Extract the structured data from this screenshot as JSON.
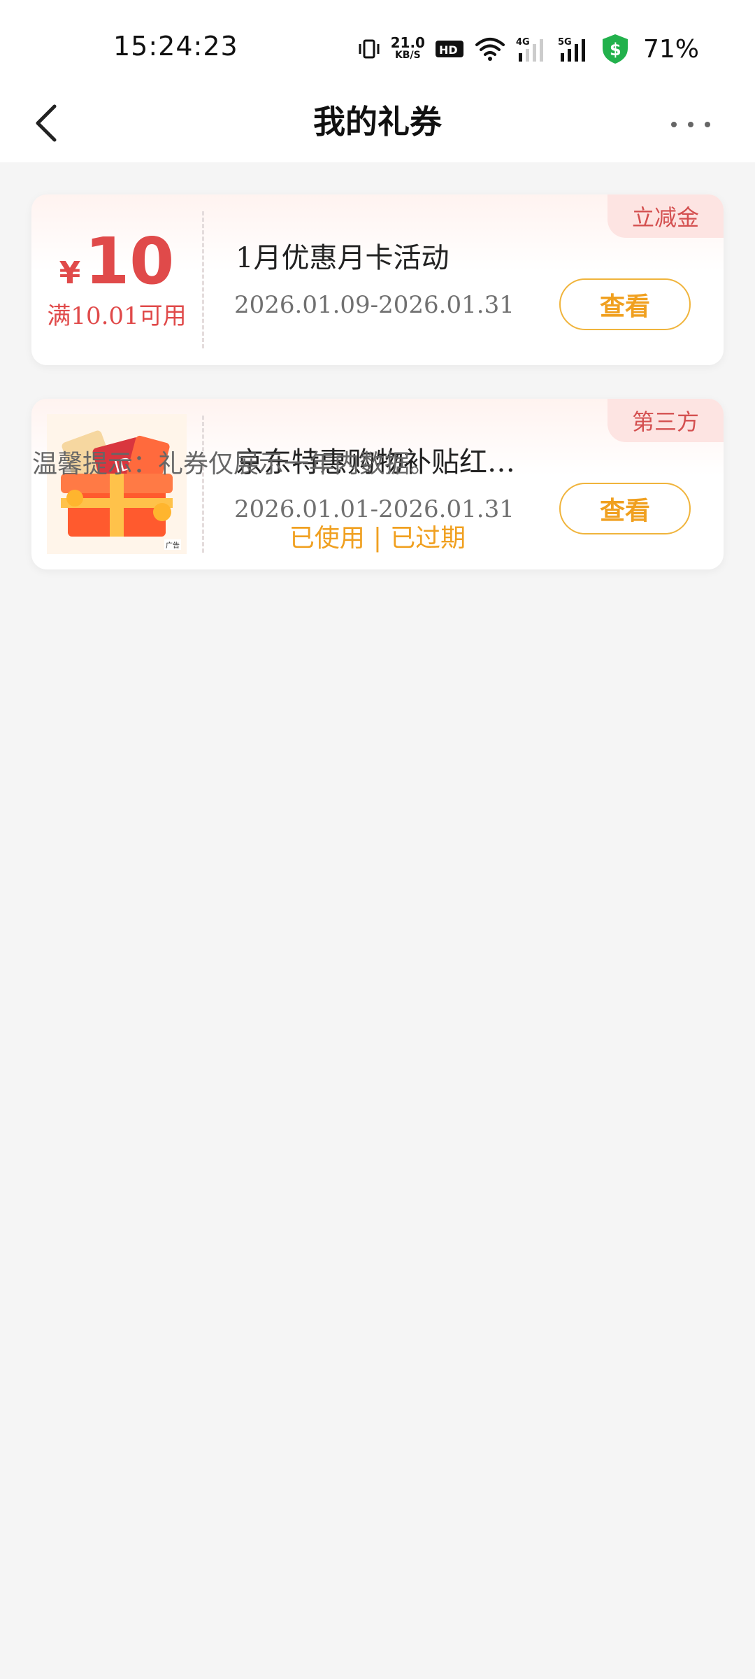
{
  "status_bar": {
    "time": "15:24:23",
    "net_speed": "21.0",
    "net_speed_unit": "KB/S",
    "battery": "71%",
    "icons": [
      "vibrate-icon",
      "hd-icon",
      "wifi-icon",
      "signal-4g-icon",
      "signal-5g-icon",
      "shield-dollar-icon"
    ]
  },
  "header": {
    "title": "我的礼券",
    "back_icon": "chevron-left-icon",
    "more_icon": "more-dots-icon"
  },
  "coupons": [
    {
      "currency": "¥",
      "amount": "10",
      "condition": "满10.01可用",
      "title": "1月优惠月卡活动",
      "date": "2026.01.09-2026.01.31",
      "button": "查看",
      "tag": "立减金"
    },
    {
      "image": "gift-box-image",
      "ad_label": "广告",
      "title": "京东特惠购物补贴红…",
      "date": "2026.01.01-2026.01.31",
      "button": "查看",
      "tag": "第三方"
    }
  ],
  "tip": "温馨提示：礼券仅展示一年内数据。",
  "links": {
    "used": "已使用",
    "separator": "|",
    "expired": "已过期"
  },
  "colors": {
    "accent": "#f0a020",
    "price": "#e04a4a",
    "tag_bg": "#fde4e2"
  }
}
